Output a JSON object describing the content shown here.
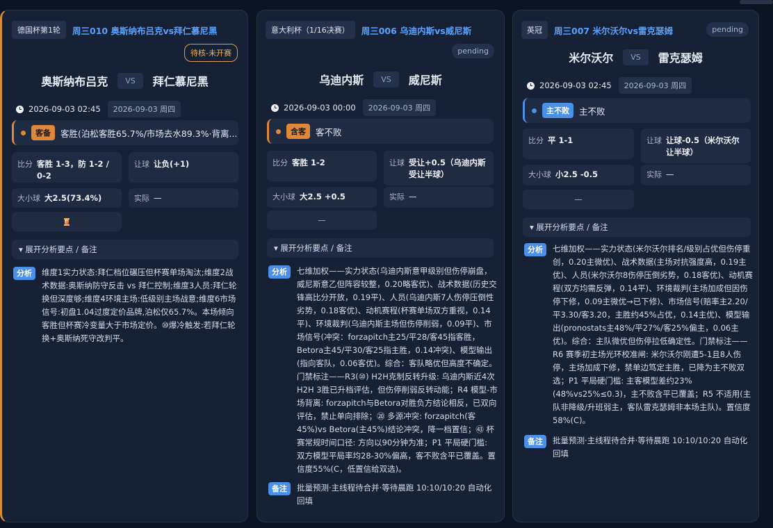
{
  "cards": [
    {
      "league": "德国杯第1轮",
      "title": "周三010 奥斯纳布吕克vs拜仁慕尼黑",
      "status": "待核-未开赛",
      "home": "奥斯纳布吕克",
      "vs": "VS",
      "away": "拜仁慕尼黑",
      "time": "2026-09-03 02:45",
      "date_tag": "2026-09-03 周四",
      "pick_tag": "客备",
      "pick_text": "客胜(泊松客胜65.7%/市场去水89.3%·背离...",
      "score_label": "比分",
      "score_value": "客胜 1-3，防 1-2 / 0-2",
      "handicap_label": "让球",
      "handicap_value": "让负(+1)",
      "ou_label": "大小球",
      "ou_value": "大2.5(73.4%)",
      "actual_label": "实际",
      "actual_value": "—",
      "expand_label": "▾ 展开分析要点 / 备注",
      "analysis_tag": "分析",
      "analysis_text": "维度1实力状态:拜仁档位碾压但杯赛单场淘汰;维度2战术数据:奥斯纳防守反击 vs 拜仁控制;维度3人员:拜仁轮换但深度够;维度4环境主场:低级别主场战意;维度6市场信号:初盘1.04过度定价品牌,泊松仅65.7%。本场倾向客胜但杯赛冷变量大于市场定价。⑩爆冷触发:若拜仁轮换+奥斯纳死守改判平。"
    },
    {
      "league": "意大利杯（1/16决赛）",
      "title": "周三006 乌迪内斯vs威尼斯",
      "status": "pending",
      "home": "乌迪内斯",
      "vs": "VS",
      "away": "威尼斯",
      "time": "2026-09-03 00:00",
      "date_tag": "2026-09-03 周四",
      "pick_tag": "含客",
      "pick_text": "客不败",
      "score_label": "比分",
      "score_value": "客胜 1-2",
      "handicap_label": "让球",
      "handicap_value": "受让+0.5（乌迪内斯受让半球）",
      "ou_label": "大小球",
      "ou_value": "大2.5 +0.5",
      "actual_label": "实际",
      "actual_value": "—",
      "bottom_value": "—",
      "expand_label": "▾ 展开分析要点 / 备注",
      "analysis_tag": "分析",
      "analysis_text": "七维加权——实力状态(乌迪内斯意甲级别但伤停崩盘，威尼斯意乙但阵容较整，0.20略客优)、战术数据(历史交锋高比分开放，0.19平)、人员(乌迪内斯7人伤停压倒性劣势，0.18客优)、动机赛程(杯赛单场双方重视，0.14平)、环境裁判(乌迪内斯主场但伤停削弱，0.09平)、市场信号(冲突：forzapitch主25/平28/客45指客胜，Betora主45/平30/客25指主胜，0.14冲突)、模型输出(指向客队，0.06客优)。综合：客队略优但高度不确定。门禁标注——R3(⑩) H2H克制反转升级: 乌迪内斯近4次H2H 3胜已升档评估，但伤停削弱反转动能；R4 模型-市场背离: forzapitch与Betora对胜负方结论相反，已双向评估，禁止单向排除；⑳ 多源冲突: forzapitch(客45%)vs Betora(主45%)结论冲突，降一档置信；㊸ 杯赛常规时间口径: 方向以90分钟为准；P1 平局硬门槛: 双方模型平局率均28-30%偏高，客不败含平已覆盖。置信度55%(C，低置信给双选)。",
      "note_tag": "备注",
      "note_text": "批量预测·主线程待合并·等待晨跑 10:10/10:20 自动化回填"
    },
    {
      "league": "英冠",
      "title": "周三007 米尔沃尔vs雷克瑟姆",
      "status": "pending",
      "home": "米尔沃尔",
      "vs": "VS",
      "away": "雷克瑟姆",
      "time": "2026-09-03 02:45",
      "date_tag": "2026-09-03 周四",
      "pick_tag": "主不败",
      "pick_text": "主不败",
      "score_label": "比分",
      "score_value": "平 1-1",
      "handicap_label": "让球",
      "handicap_value": "让球-0.5（米尔沃尔让半球）",
      "ou_label": "大小球",
      "ou_value": "小2.5 -0.5",
      "actual_label": "实际",
      "actual_value": "—",
      "bottom_value": "—",
      "expand_label": "▾ 展开分析要点 / 备注",
      "analysis_tag": "分析",
      "analysis_text": "七维加权——实力状态(米尔沃尔排名/级别占优但伤停重创，0.20主微优)、战术数据(主场对抗强度高，0.19主优)、人员(米尔沃尔8伤停压倒劣势，0.18客优)、动机赛程(双方均需反弹，0.14平)、环境裁判(主场加成但因伤停下修，0.09主微优→已下修)、市场信号(赔率主2.20/平3.30/客3.20，主胜约45%占优，0.14主优)、模型输出(pronostats主48%/平27%/客25%偏主，0.06主优)。综合：主队微优但伤停拉低确定性。门禁标注——R6 赛季初主场光环校准闸: 米尔沃尔刚遭5-1且8人伤停，主场加成下修，禁单边笃定主胜，已降为主不败双选；P1 平局硬门槛: 主客模型差约23%(48%vs25%≤0.3)，主不败含平已覆盖；R5 不适用(主队非降级/升班弱主，客队雷克瑟姆非本场主队)。置信度58%(C)。",
      "note_tag": "备注",
      "note_text": "批量预测·主线程待合并·等待晨跑 10:10/10:20 自动化回填"
    }
  ],
  "colors": {
    "accent_orange": "#e0883a",
    "accent_blue": "#4a8fe8",
    "link_blue": "#5aa2ff",
    "card_bg": "#162136"
  }
}
